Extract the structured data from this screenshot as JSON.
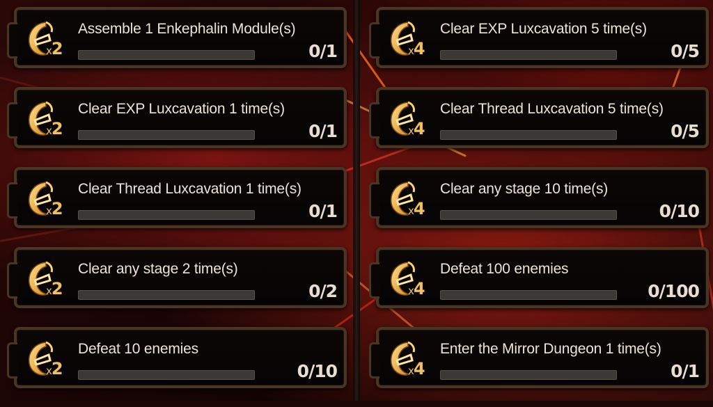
{
  "left_missions": [
    {
      "reward_count": "2",
      "title": "Assemble 1 Enkephalin Module(s)",
      "progress": "0/1",
      "progress_fraction": 0
    },
    {
      "reward_count": "2",
      "title": "Clear EXP Luxcavation 1 time(s)",
      "progress": "0/1",
      "progress_fraction": 0
    },
    {
      "reward_count": "2",
      "title": "Clear Thread Luxcavation 1 time(s)",
      "progress": "0/1",
      "progress_fraction": 0
    },
    {
      "reward_count": "2",
      "title": "Clear any stage 2 time(s)",
      "progress": "0/2",
      "progress_fraction": 0
    },
    {
      "reward_count": "2",
      "title": "Defeat 10 enemies",
      "progress": "0/10",
      "progress_fraction": 0
    }
  ],
  "right_missions": [
    {
      "reward_count": "4",
      "title": "Clear EXP Luxcavation 5 time(s)",
      "progress": "0/5",
      "progress_fraction": 0
    },
    {
      "reward_count": "4",
      "title": "Clear Thread Luxcavation 5 time(s)",
      "progress": "0/5",
      "progress_fraction": 0
    },
    {
      "reward_count": "4",
      "title": "Clear any stage 10 time(s)",
      "progress": "0/10",
      "progress_fraction": 0
    },
    {
      "reward_count": "4",
      "title": "Defeat 100 enemies",
      "progress": "0/100",
      "progress_fraction": 0
    },
    {
      "reward_count": "4",
      "title": "Enter the Mirror Dungeon 1 time(s)",
      "progress": "0/1",
      "progress_fraction": 0
    }
  ],
  "reward_icon": "lunacy-crescent-icon",
  "multiplier_symbol": "x",
  "colors": {
    "accent_gold": "#f0c060",
    "card_border": "#4a3424",
    "bar_bg": "#3b3836",
    "text": "#ece4d8"
  }
}
